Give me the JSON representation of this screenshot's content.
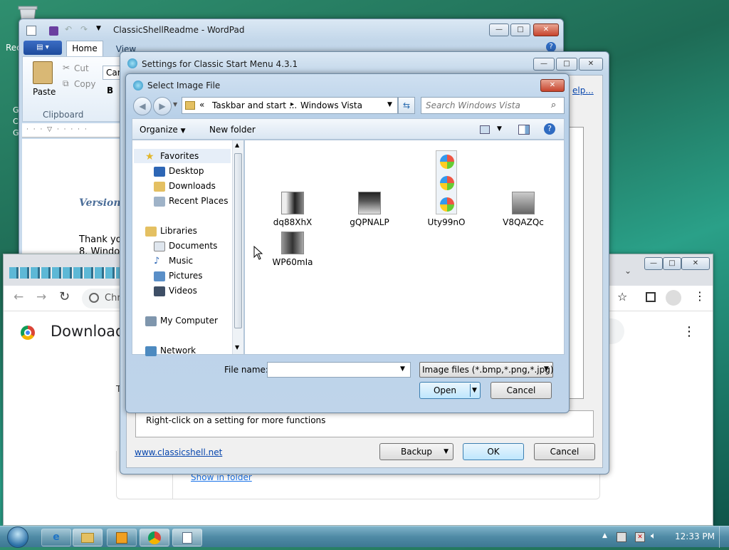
{
  "desktop": {
    "recycle_label": "Rec",
    "side_letters": [
      "G",
      "C",
      "G"
    ]
  },
  "wordpad": {
    "title": "ClassicShellReadme - WordPad",
    "tabs": [
      "Home",
      "View"
    ],
    "paste": "Paste",
    "cut": "Cut",
    "copy": "Copy",
    "group": "Clipboard",
    "font_box": "Cam",
    "bold": "B",
    "doc_version": "Version",
    "doc_line1": "Thank yo",
    "doc_line2": "8. Windo"
  },
  "settings": {
    "title": "Settings for Classic Start Menu 4.3.1",
    "help_link": "elp...",
    "status_text": "Right-click on a setting for more functions",
    "website_link": "www.classicshell.net",
    "backup": "Backup",
    "ok": "OK",
    "cancel": "Cancel"
  },
  "dialog": {
    "title": "Select Image File",
    "breadcrumb_prefix": "«",
    "breadcrumb_1": "Taskbar and start ...",
    "breadcrumb_sep": "▸",
    "breadcrumb_2": "Windows Vista",
    "search_placeholder": "Search Windows Vista",
    "organize": "Organize",
    "new_folder": "New folder",
    "nav": {
      "favorites": "Favorites",
      "desktop": "Desktop",
      "downloads": "Downloads",
      "recent": "Recent Places",
      "libraries": "Libraries",
      "documents": "Documents",
      "music": "Music",
      "pictures": "Pictures",
      "videos": "Videos",
      "computer": "My Computer",
      "network": "Network"
    },
    "files": [
      "dq88XhX",
      "gQPNALP",
      "Uty99nO",
      "V8QAZQc",
      "WP60mIa"
    ],
    "file_name_label": "File name:",
    "file_name_value": "",
    "filter": "Image files (*.bmp,*.png,*.jpg)",
    "open": "Open",
    "cancel": "Cancel"
  },
  "chrome": {
    "back_glyph": "←",
    "fwd_glyph": "→",
    "reload_glyph": "↻",
    "addr_partial": "Chr",
    "heading_partial": "Download",
    "side_T": "T",
    "show_in_folder": "Show in folder"
  },
  "taskbar": {
    "clock": "12:33 PM"
  }
}
